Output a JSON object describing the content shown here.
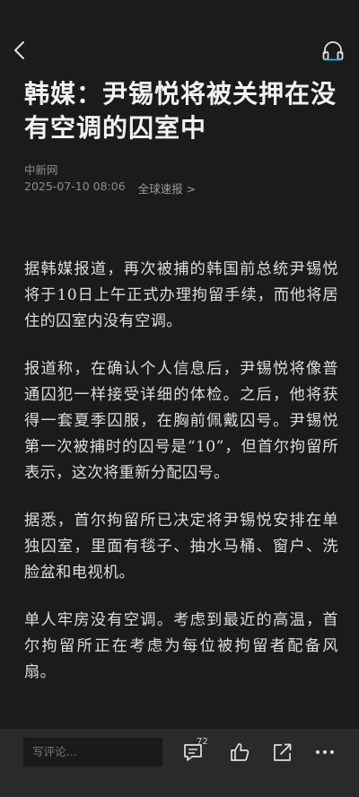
{
  "article": {
    "title": "韩媒：尹锡悦将被关押在没有空调的囚室中",
    "source": "中新网",
    "datetime": "2025-07-10 08:06",
    "channel": "全球速报 >",
    "paragraphs": [
      "据韩媒报道，再次被捕的韩国前总统尹锡悦将于10日上午正式办理拘留手续，而他将居住的囚室内没有空调。",
      "报道称，在确认个人信息后，尹锡悦将像普通囚犯一样接受详细的体检。之后，他将获得一套夏季囚服，在胸前佩戴囚号。尹锡悦第一次被捕时的囚号是“10”，但首尔拘留所表示，这次将重新分配囚号。",
      "据悉，首尔拘留所已决定将尹锡悦安排在单独囚室，里面有毯子、抽水马桶、窗户、洗脸盆和电视机。",
      "单人牢房没有空调。考虑到最近的高温，首尔拘留所正在考虑为每位被拘留者配备风扇。"
    ]
  },
  "bottombar": {
    "comment_placeholder": "写评论…",
    "comment_count": "72"
  },
  "icons": {
    "back": "back-arrow-icon",
    "listen": "headphones-icon",
    "comment": "comment-icon",
    "like": "thumbs-up-icon",
    "share": "share-icon",
    "more": "more-dots-icon"
  },
  "colors": {
    "background": "#1b1b1d",
    "bottom_bar": "#2a2a2c",
    "text": "#dddddd",
    "meta": "#8d8d90"
  }
}
